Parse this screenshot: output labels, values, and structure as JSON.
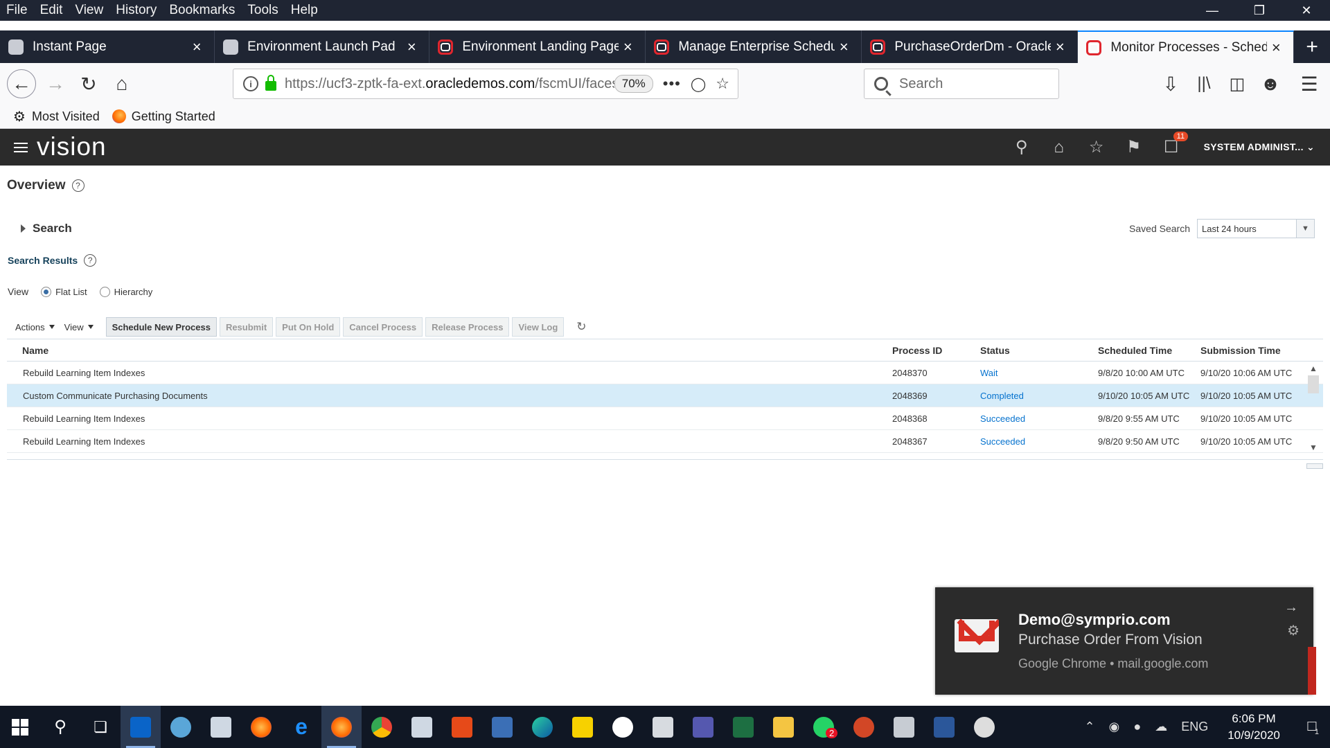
{
  "menubar": {
    "items": [
      "File",
      "Edit",
      "View",
      "History",
      "Bookmarks",
      "Tools",
      "Help"
    ]
  },
  "tabs": [
    {
      "label": "Instant Page",
      "icon": "grey"
    },
    {
      "label": "Environment Launch Pad",
      "icon": "grey"
    },
    {
      "label": "Environment Landing Page",
      "icon": "oracle"
    },
    {
      "label": "Manage Enterprise Schedule",
      "icon": "oracle"
    },
    {
      "label": "PurchaseOrderDm - Oracle I",
      "icon": "oracle"
    },
    {
      "label": "Monitor Processes - Schedu",
      "icon": "oracle",
      "active": true
    }
  ],
  "urlbar": {
    "prefix": "https://ucf3-zptk-fa-ext.",
    "domain": "oracledemos.com",
    "path": "/fscmUI/faces/Fuse",
    "zoom": "70%"
  },
  "browser_search": {
    "placeholder": "Search"
  },
  "bookmarks": {
    "most_visited": "Most Visited",
    "getting_started": "Getting Started"
  },
  "app": {
    "logo": "vision",
    "user": "SYSTEM ADMINIST...",
    "notification_count": "11"
  },
  "page": {
    "title": "Overview",
    "search_section": "Search",
    "saved_search_label": "Saved Search",
    "saved_search_value": "Last 24 hours",
    "search_results": "Search Results",
    "view_label": "View",
    "view_options": [
      "Flat List",
      "Hierarchy"
    ]
  },
  "toolbar": {
    "actions": "Actions",
    "view": "View",
    "schedule_new": "Schedule New Process",
    "resubmit": "Resubmit",
    "put_on_hold": "Put On Hold",
    "cancel_process": "Cancel Process",
    "release_process": "Release Process",
    "view_log": "View Log"
  },
  "table": {
    "columns": [
      "Name",
      "Process ID",
      "Status",
      "Scheduled Time",
      "Submission Time"
    ],
    "rows": [
      {
        "name": "Rebuild Learning Item Indexes",
        "id": "2048370",
        "status": "Wait",
        "scheduled": "9/8/20 10:00 AM UTC",
        "submitted": "9/10/20 10:06 AM UTC"
      },
      {
        "name": "Custom Communicate Purchasing Documents",
        "id": "2048369",
        "status": "Completed",
        "scheduled": "9/10/20 10:05 AM UTC",
        "submitted": "9/10/20 10:05 AM UTC",
        "selected": true
      },
      {
        "name": "Rebuild Learning Item Indexes",
        "id": "2048368",
        "status": "Succeeded",
        "scheduled": "9/8/20 9:55 AM UTC",
        "submitted": "9/10/20 10:05 AM UTC"
      },
      {
        "name": "Rebuild Learning Item Indexes",
        "id": "2048367",
        "status": "Succeeded",
        "scheduled": "9/8/20 9:50 AM UTC",
        "submitted": "9/10/20 10:05 AM UTC"
      }
    ]
  },
  "notification": {
    "from": "Demo@symprio.com",
    "subject": "Purchase Order From Vision",
    "source": "Google Chrome • mail.google.com"
  },
  "taskbar": {
    "whatsapp_badge": "2",
    "language": "ENG",
    "time": "6:06 PM",
    "date": "10/9/2020",
    "action_center_count": "1"
  },
  "colors": {
    "chrome_dark": "#1f2533",
    "app_header": "#2b2b2b",
    "link_blue": "#0572ce",
    "selected_row": "#d6ecf9",
    "oracle_red": "#e0262e"
  }
}
